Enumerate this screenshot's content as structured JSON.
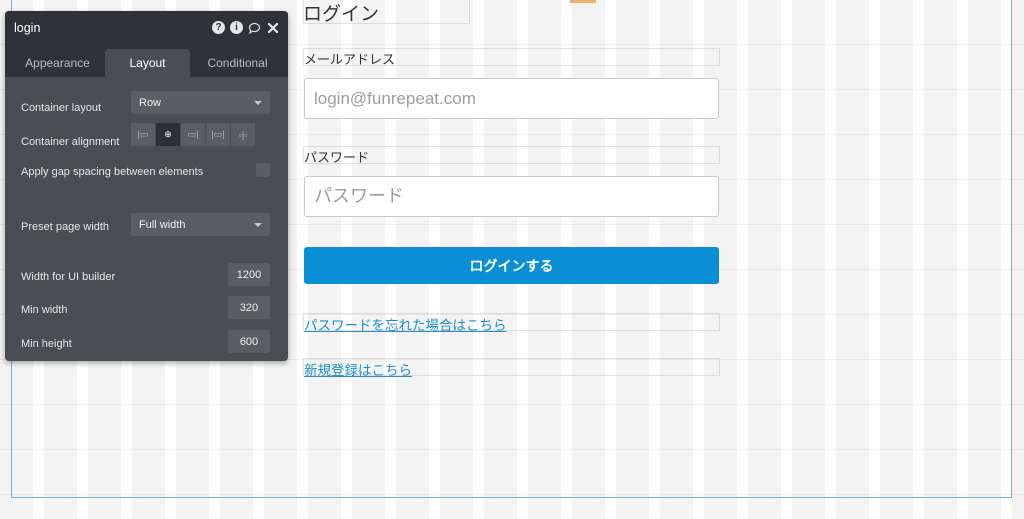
{
  "panel": {
    "title": "login",
    "header_icons": [
      "help-icon",
      "info-icon",
      "comment-icon",
      "close-icon"
    ],
    "tabs": [
      {
        "label": "Appearance",
        "active": false
      },
      {
        "label": "Layout",
        "active": true
      },
      {
        "label": "Conditional",
        "active": false
      }
    ],
    "container_layout": {
      "label": "Container layout",
      "value": "Row"
    },
    "container_alignment": {
      "label": "Container alignment",
      "selected_index": 1
    },
    "gap_spacing": {
      "label": "Apply gap spacing between elements",
      "checked": false
    },
    "preset_page_width": {
      "label": "Preset page width",
      "value": "Full width"
    },
    "width_ui_builder": {
      "label": "Width for UI builder",
      "value": "1200"
    },
    "min_width": {
      "label": "Min width",
      "value": "320"
    },
    "min_height": {
      "label": "Min height",
      "value": "600"
    }
  },
  "form": {
    "title": "ログイン",
    "email_label": "メールアドレス",
    "email_placeholder": "login@funrepeat.com",
    "password_label": "パスワード",
    "password_placeholder": "パスワード",
    "login_button": "ログインする",
    "forgot_link": "パスワードを忘れた場合はこちら",
    "signup_link": "新規登録はこちら"
  },
  "colors": {
    "primary_button": "#0a8fd6",
    "link": "#1e8fd0",
    "panel_bg": "#4a4e53",
    "panel_header": "#2f3337"
  }
}
